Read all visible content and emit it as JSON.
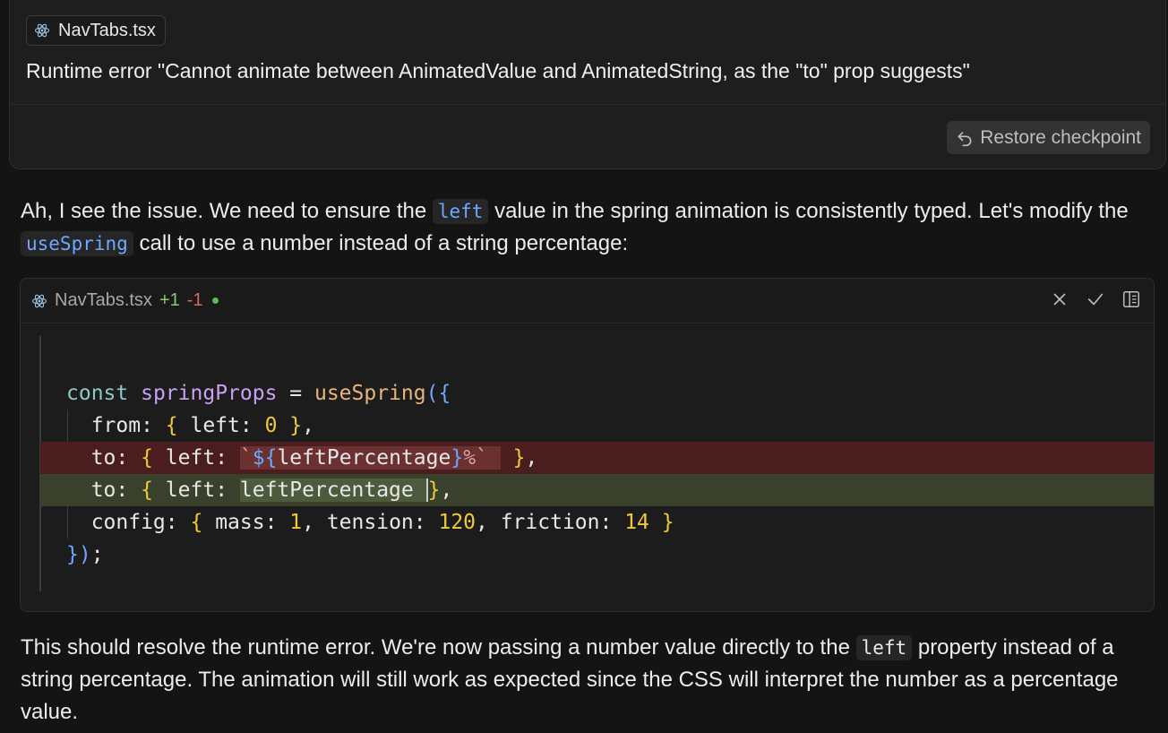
{
  "user_message": {
    "file_chip": "NavTabs.tsx",
    "text": "Runtime error \"Cannot animate between AnimatedValue and AnimatedString, as the \"to\" prop suggests\"",
    "restore_label": "Restore checkpoint"
  },
  "assistant": {
    "p1_before": "Ah, I see the issue. We need to ensure the ",
    "p1_code1": "left",
    "p1_mid": " value in the spring animation is consistently typed. Let's modify the ",
    "p1_code2": "useSpring",
    "p1_after": " call to use a number instead of a string percentage:",
    "p2_before": "This should resolve the runtime error. We're now passing a number value directly to the ",
    "p2_code": "left",
    "p2_after": " property instead of a string percentage. The animation will still work as expected since the CSS will interpret the number as a percentage value."
  },
  "code_block": {
    "filename": "NavTabs.tsx",
    "added": "+1",
    "removed": "-1",
    "icons": [
      "close-icon",
      "check-icon",
      "panel-icon"
    ]
  }
}
